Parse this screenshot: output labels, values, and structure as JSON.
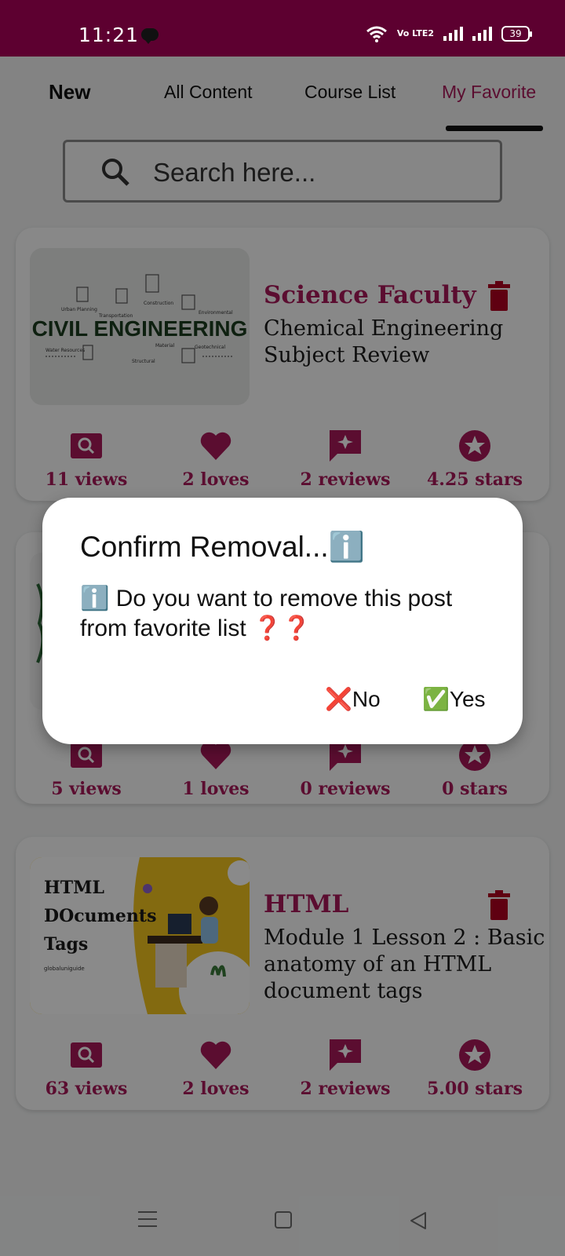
{
  "status_bar": {
    "time": "11:21",
    "battery": "39",
    "network_label": "Vo LTE2"
  },
  "tabs": [
    {
      "label": "New"
    },
    {
      "label": "All Content"
    },
    {
      "label": "Course List"
    },
    {
      "label": "My Favorite"
    }
  ],
  "active_tab": "My Favorite",
  "search": {
    "placeholder": "Search here..."
  },
  "cards": [
    {
      "thumb_text": "CIVIL ENGINEERING",
      "thumb_labels": [
        "Urban Planning",
        "Transportation",
        "Construction",
        "Environmental",
        "Water Resources",
        "Material",
        "Structural",
        "Geotechnical"
      ],
      "title": "Science Faculty",
      "subtitle": "Chemical Engineering Subject Review",
      "stats": {
        "views": "11 views",
        "loves": "2 loves",
        "reviews": "2 reviews",
        "stars": "4.25 stars"
      }
    },
    {
      "title": "",
      "subtitle": "",
      "stats": {
        "views": "5 views",
        "loves": "1 loves",
        "reviews": "0 reviews",
        "stars": "0 stars"
      }
    },
    {
      "thumb_text": "HTML DOcuments Tags",
      "thumb_line1": "HTML",
      "thumb_line2": "DOcuments",
      "thumb_line3": "Tags",
      "thumb_small": "globaluniguide",
      "title": "HTML",
      "subtitle": "Module 1  Lesson 2 : Basic anatomy of an HTML document tags",
      "stats": {
        "views": "63 views",
        "loves": "2 loves",
        "reviews": "2 reviews",
        "stars": "5.00 stars"
      }
    }
  ],
  "dialog": {
    "title": "Confirm Removal...ℹ️",
    "message": "ℹ️ Do you want to remove this post from favorite list ❓❓",
    "no_label": "❌No",
    "yes_label": "✅Yes"
  },
  "colors": {
    "status_bar": "#5d0030",
    "accent": "#a8195a",
    "trash": "#b00020"
  }
}
